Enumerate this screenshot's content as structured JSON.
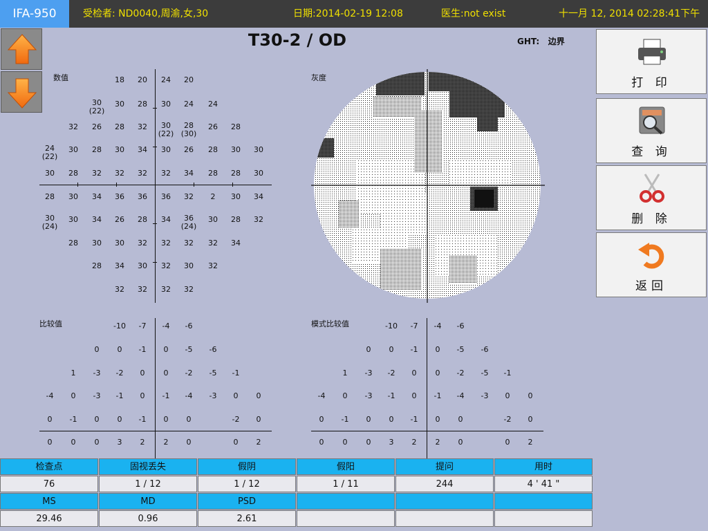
{
  "topbar": {
    "app_title": "IFA-950",
    "patient": "受检者: ND0040,周渝,女,30",
    "date": "日期:2014-02-19 12:08",
    "doctor": "医生:not exist",
    "clock": "十一月 12, 2014 02:28:41下午"
  },
  "test_title": "T30-2 / OD",
  "ght": {
    "label": "GHT:",
    "value": "边界"
  },
  "panels": {
    "values_label": "数值",
    "gray_label": "灰度",
    "total_dev_label": "比较值",
    "pattern_dev_label": "模式比较值"
  },
  "sensitivity_rows": [
    [
      null,
      null,
      null,
      "18",
      "20",
      "24",
      "20",
      null,
      null,
      null
    ],
    [
      null,
      null,
      "30",
      "30",
      "28",
      "30",
      "24",
      "24",
      null,
      null
    ],
    [
      null,
      "32",
      "26",
      "28",
      "32",
      "30",
      "28",
      "26",
      "28",
      null
    ],
    [
      "24",
      "30",
      "28",
      "30",
      "34",
      "30",
      "26",
      "28",
      "30",
      "30"
    ],
    [
      "30",
      "28",
      "32",
      "32",
      "32",
      "32",
      "34",
      "28",
      "28",
      "30"
    ],
    [
      "28",
      "30",
      "34",
      "36",
      "36",
      "36",
      "32",
      "2",
      "30",
      "34"
    ],
    [
      "30",
      "30",
      "34",
      "26",
      "28",
      "34",
      "36",
      "30",
      "28",
      "32"
    ],
    [
      null,
      "28",
      "30",
      "30",
      "32",
      "32",
      "32",
      "32",
      "34",
      null
    ],
    [
      null,
      null,
      "28",
      "34",
      "30",
      "32",
      "30",
      "32",
      null,
      null
    ],
    [
      null,
      null,
      null,
      "32",
      "32",
      "32",
      "32",
      null,
      null,
      null
    ]
  ],
  "sensitivity_repeats": [
    {
      "row": 1,
      "col": 2,
      "text": "(22)"
    },
    {
      "row": 2,
      "col": 5,
      "text": "(22)"
    },
    {
      "row": 2,
      "col": 6,
      "text": "(30)"
    },
    {
      "row": 3,
      "col": 0,
      "text": "(22)"
    },
    {
      "row": 6,
      "col": 0,
      "text": "(24)"
    },
    {
      "row": 6,
      "col": 6,
      "text": "(24)"
    }
  ],
  "total_deviation_rows": [
    [
      null,
      null,
      null,
      "-10",
      "-7",
      "-4",
      "-6",
      null,
      null,
      null
    ],
    [
      null,
      null,
      "0",
      "0",
      "-1",
      "0",
      "-5",
      "-6",
      null,
      null
    ],
    [
      null,
      "1",
      "-3",
      "-2",
      "0",
      "0",
      "-2",
      "-5",
      "-1",
      null
    ],
    [
      "-4",
      "0",
      "-3",
      "-1",
      "0",
      "-1",
      "-4",
      "-3",
      "0",
      "0"
    ],
    [
      "0",
      "-1",
      "0",
      "0",
      "-1",
      "0",
      "0",
      null,
      "-2",
      "0"
    ],
    [
      "0",
      "0",
      "0",
      "3",
      "2",
      "2",
      "0",
      null,
      "0",
      "2"
    ]
  ],
  "pattern_deviation_rows": [
    [
      null,
      null,
      null,
      "-10",
      "-7",
      "-4",
      "-6",
      null,
      null,
      null
    ],
    [
      null,
      null,
      "0",
      "0",
      "-1",
      "0",
      "-5",
      "-6",
      null,
      null
    ],
    [
      null,
      "1",
      "-3",
      "-2",
      "0",
      "0",
      "-2",
      "-5",
      "-1",
      null
    ],
    [
      "-4",
      "0",
      "-3",
      "-1",
      "0",
      "-1",
      "-4",
      "-3",
      "0",
      "0"
    ],
    [
      "0",
      "-1",
      "0",
      "0",
      "-1",
      "0",
      "0",
      null,
      "-2",
      "0"
    ],
    [
      "0",
      "0",
      "0",
      "3",
      "2",
      "2",
      "0",
      null,
      "0",
      "2"
    ]
  ],
  "side_buttons": {
    "print": "打 印",
    "query": "查 询",
    "delete": "删 除",
    "back": "返回"
  },
  "stats": {
    "header1": [
      "检查点",
      "固视丢失",
      "假阴",
      "假阳",
      "提问",
      "用时"
    ],
    "values1": [
      "76",
      "1 / 12",
      "1 / 12",
      "1 / 11",
      "244",
      "4 ' 41 \""
    ],
    "header2": [
      "MS",
      "MD",
      "PSD",
      "",
      "",
      ""
    ],
    "values2": [
      "29.46",
      "0.96",
      "2.61",
      "",
      "",
      ""
    ]
  }
}
